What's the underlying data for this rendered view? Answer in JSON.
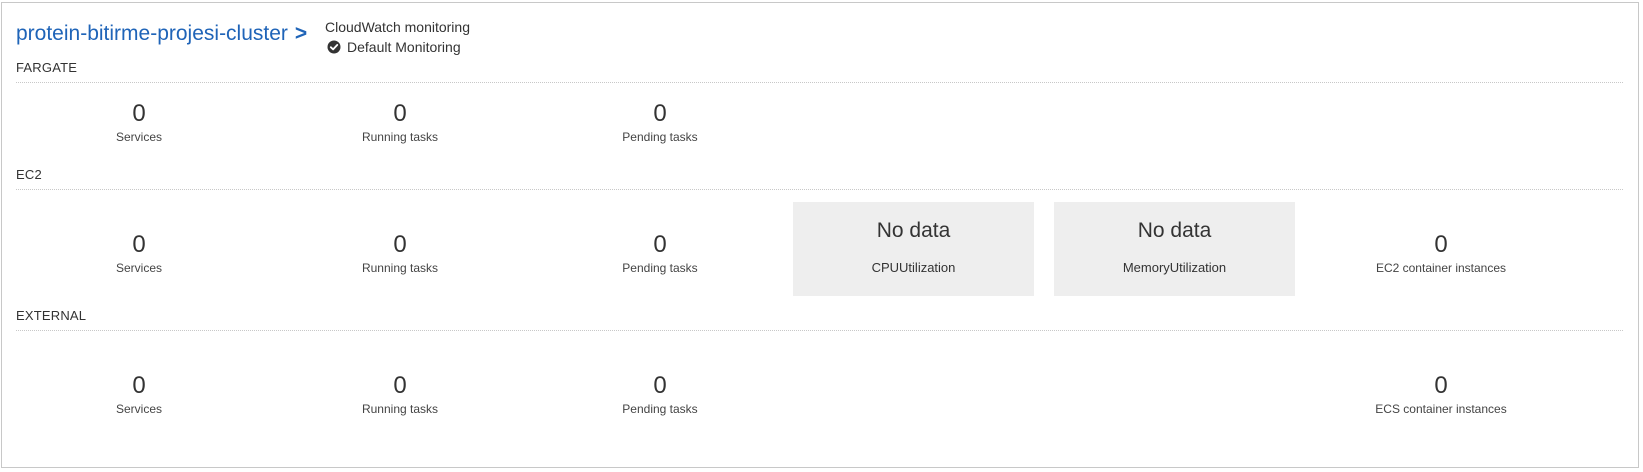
{
  "header": {
    "cluster_name": "protein-bitirme-projesi-cluster",
    "chevron": ">",
    "cloudwatch_label": "CloudWatch monitoring",
    "cloudwatch_status": "Default Monitoring"
  },
  "sections": {
    "fargate": {
      "label": "FARGATE",
      "services": {
        "value": "0",
        "label": "Services"
      },
      "running": {
        "value": "0",
        "label": "Running tasks"
      },
      "pending": {
        "value": "0",
        "label": "Pending tasks"
      }
    },
    "ec2": {
      "label": "EC2",
      "services": {
        "value": "0",
        "label": "Services"
      },
      "running": {
        "value": "0",
        "label": "Running tasks"
      },
      "pending": {
        "value": "0",
        "label": "Pending tasks"
      },
      "cpu": {
        "value": "No data",
        "label": "CPUUtilization"
      },
      "memory": {
        "value": "No data",
        "label": "MemoryUtilization"
      },
      "instances": {
        "value": "0",
        "label": "EC2 container instances"
      }
    },
    "external": {
      "label": "EXTERNAL",
      "services": {
        "value": "0",
        "label": "Services"
      },
      "running": {
        "value": "0",
        "label": "Running tasks"
      },
      "pending": {
        "value": "0",
        "label": "Pending tasks"
      },
      "instances": {
        "value": "0",
        "label": "ECS container instances"
      }
    }
  },
  "colors": {
    "link": "#1f64b8",
    "tile_bg": "#eeeeee",
    "border": "#c8c8c8",
    "text": "#333333"
  },
  "icons": {
    "status": "check-circle-icon"
  }
}
